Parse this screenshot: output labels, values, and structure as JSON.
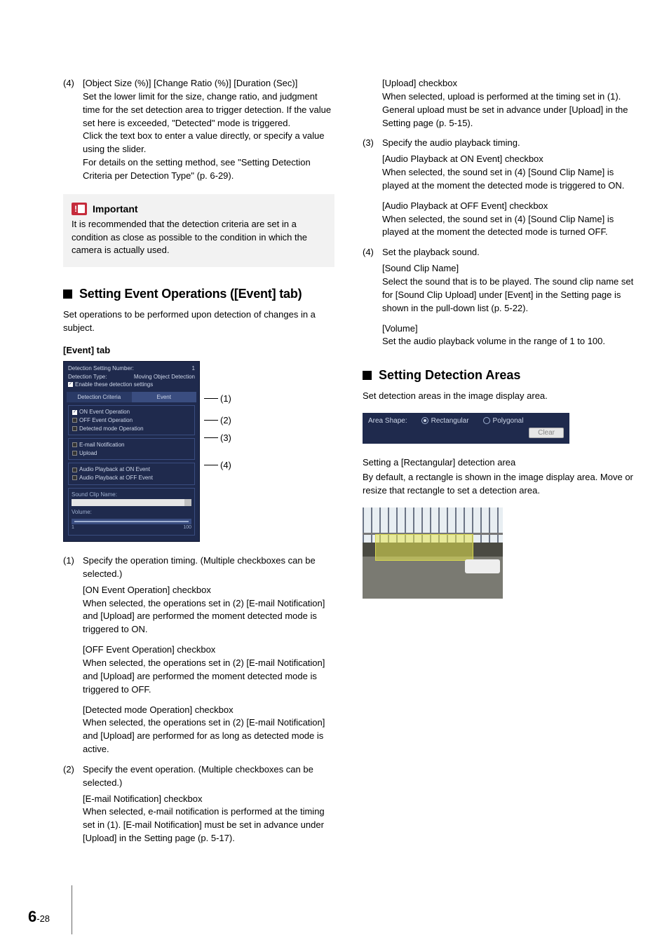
{
  "left": {
    "item4_num": "(4)",
    "item4_title": "[Object Size (%)] [Change Ratio (%)] [Duration (Sec)]",
    "item4_p1": "Set the lower limit for the size, change ratio, and judgment time for the set detection area to trigger detection. If the value set here is exceeded, \"Detected\" mode is triggered.",
    "item4_p2": "Click the text box to enter a value directly, or specify a value using the slider.",
    "item4_p3": "For details on the setting method, see \"Setting Detection Criteria per Detection Type\" (p. 6-29).",
    "important_label": "Important",
    "important_text": "It is recommended that the detection criteria are set in a condition as close as possible to the condition in which the camera is actually used.",
    "section_event": "Setting Event Operations ([Event] tab)",
    "event_intro": "Set operations to be performed upon detection of changes in a subject.",
    "event_tab_label": "[Event] tab",
    "panel": {
      "row1_l": "Detection Setting Number:",
      "row1_r": "1",
      "row2_l": "Detection Type:",
      "row2_r": "Moving Object Detection",
      "enable": "Enable these detection settings",
      "tab1": "Detection Criteria",
      "tab2": "Event",
      "g1a": "ON Event Operation",
      "g1b": "OFF Event Operation",
      "g1c": "Detected mode Operation",
      "g2a": "E-mail Notification",
      "g2b": "Upload",
      "g3a": "Audio Playback at ON Event",
      "g3b": "Audio Playback at OFF Event",
      "snd_name": "Sound Clip Name:",
      "vol": "Volume:",
      "range_lo": "1",
      "range_hi": "100"
    },
    "co1": "(1)",
    "co2": "(2)",
    "co3": "(3)",
    "co4": "(4)",
    "l1_num": "(1)",
    "l1_lead": "Specify the operation timing. (Multiple checkboxes can be selected.)",
    "l1a_h": "[ON Event Operation] checkbox",
    "l1a_b": "When selected, the operations set in (2) [E-mail Notification] and [Upload] are performed the moment detected mode is triggered to ON.",
    "l1b_h": "[OFF Event Operation] checkbox",
    "l1b_b": "When selected, the operations set in (2) [E-mail Notification] and [Upload] are performed the moment detected mode is triggered to OFF.",
    "l1c_h": "[Detected mode Operation] checkbox",
    "l1c_b": "When selected, the operations set in (2) [E-mail Notification] and [Upload] are performed for as long as detected mode is active.",
    "l2_num": "(2)",
    "l2_lead": "Specify the event operation. (Multiple checkboxes can be selected.)",
    "l2a_h": "[E-mail Notification] checkbox",
    "l2a_b": "When selected, e-mail notification is performed at the timing set in (1). [E-mail Notification] must be set in advance under [Upload] in the Setting page (p. 5-17)."
  },
  "right": {
    "r_upload_h": "[Upload] checkbox",
    "r_upload_b": "When selected, upload is performed at the timing set in (1). General upload must be set in advance under [Upload] in the Setting page (p. 5-15).",
    "r3_num": "(3)",
    "r3_lead": "Specify the audio playback timing.",
    "r3a_h": "[Audio Playback at ON Event] checkbox",
    "r3a_b": "When selected, the sound set in (4) [Sound Clip Name] is played at the moment the detected mode is triggered to ON.",
    "r3b_h": "[Audio Playback at OFF Event] checkbox",
    "r3b_b": "When selected, the sound set in (4)  [Sound Clip Name] is played at the moment the detected mode is turned OFF.",
    "r4_num": "(4)",
    "r4_lead": "Set the playback sound.",
    "r4a_h": "[Sound Clip Name]",
    "r4a_b": "Select the sound that is to be played. The sound clip name set for [Sound Clip Upload] under [Event] in the Setting page is shown in the pull-down list (p. 5-22).",
    "r4b_h": "[Volume]",
    "r4b_b": "Set the audio playback volume in the range of 1 to 100.",
    "section_areas": "Setting Detection Areas",
    "areas_intro": "Set detection areas in the image display area.",
    "area_shape_label": "Area Shape:",
    "area_rect": "Rectangular",
    "area_poly": "Polygonal",
    "area_clear": "Clear",
    "rect_h": "Setting a [Rectangular] detection area",
    "rect_b": "By default, a rectangle is shown in the image display area. Move or resize that rectangle to set a detection area."
  },
  "footer": {
    "big": "6",
    "rest": "-28"
  }
}
